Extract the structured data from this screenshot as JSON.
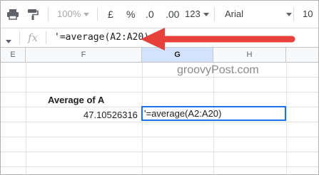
{
  "toolbar": {
    "zoom": "100%",
    "currency": "£",
    "percent": "%",
    "dec_decrease": ".0",
    "dec_increase": ".00",
    "more_formats": "123",
    "font": "Arial",
    "font_size": "10"
  },
  "formula_bar": {
    "fx_label": "fx",
    "content": "'=average(A2:A20)"
  },
  "columns": [
    "E",
    "F",
    "G",
    "H"
  ],
  "selected_column": "G",
  "watermark": "groovyPost.com",
  "cells": {
    "label": "Average of A",
    "value": "47.10526316",
    "active_cell_text": "'=average(A2:A20)"
  },
  "colors": {
    "accent": "#1a73e8",
    "arrow": "#e8413b",
    "selected_header": "#d3e3fd"
  }
}
